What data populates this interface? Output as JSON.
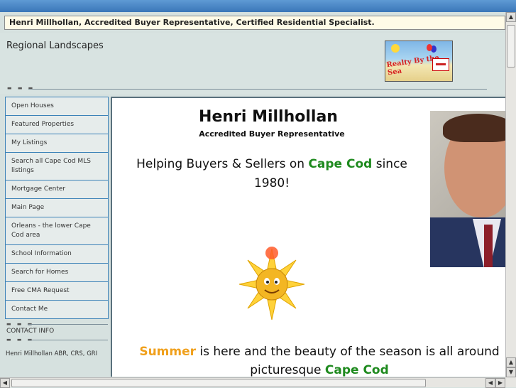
{
  "header": {
    "title": "Henri Millhollan, Accredited Buyer Representative, Certified Residential Specialist."
  },
  "subheader": {
    "site_name": "Regional Landscapes",
    "logo_text": "Realty By the Sea"
  },
  "sidebar": {
    "items": [
      {
        "label": "Open Houses"
      },
      {
        "label": "Featured Properties"
      },
      {
        "label": "My Listings"
      },
      {
        "label": "Search all Cape Cod MLS listings"
      },
      {
        "label": "Mortgage Center"
      },
      {
        "label": "Main Page"
      },
      {
        "label": "Orleans - the lower Cape Cod area"
      },
      {
        "label": "School Information"
      },
      {
        "label": "Search for Homes"
      },
      {
        "label": "Free CMA Request"
      },
      {
        "label": "Contact Me"
      }
    ],
    "contact_heading": "CONTACT INFO",
    "contact_text": "Henri Millhollan ABR, CRS, GRI"
  },
  "main": {
    "name": "Henri Millhollan",
    "role": "Accredited Buyer Representative",
    "tagline_pre": "Helping Buyers & Sellers on ",
    "tagline_highlight": "Cape Cod",
    "tagline_post": " since 1980!",
    "summer_word": "Summer",
    "summer_mid": " is here and the beauty of the season is all around picturesque ",
    "summer_highlight": "Cape Cod"
  },
  "colors": {
    "accent_green": "#1e8a1e",
    "accent_orange": "#f0a01c",
    "nav_border": "#3c82b8"
  },
  "icons": {
    "sun": "sun-icon",
    "photo": "agent-photo"
  }
}
